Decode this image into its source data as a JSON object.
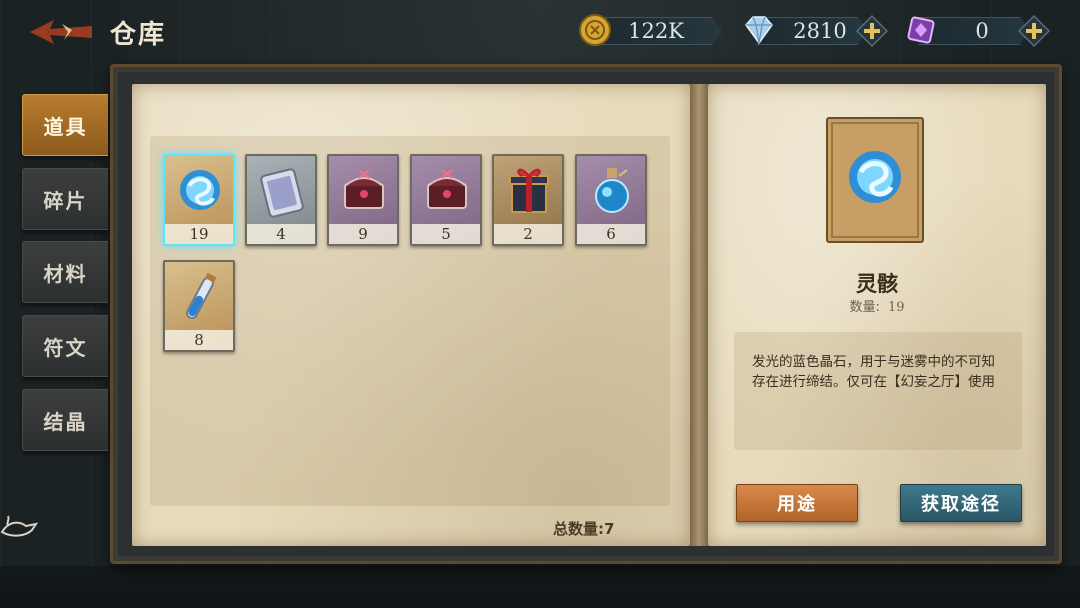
{
  "header": {
    "title": "仓库",
    "currencies": [
      {
        "name": "coin",
        "value": "122K",
        "icon": "gold-coin-icon",
        "has_plus": false
      },
      {
        "name": "diamond",
        "value": "2810",
        "icon": "diamond-icon",
        "has_plus": true
      },
      {
        "name": "crystal",
        "value": "0",
        "icon": "purple-crystal-icon",
        "has_plus": true
      }
    ]
  },
  "tabs": [
    {
      "label": "道具",
      "active": true
    },
    {
      "label": "碎片",
      "active": false
    },
    {
      "label": "材料",
      "active": false
    },
    {
      "label": "符文",
      "active": false
    },
    {
      "label": "结晶",
      "active": false
    }
  ],
  "items": [
    {
      "icon": "blue-spirit-orb-icon",
      "count": "19",
      "rarity": "gold",
      "selected": true
    },
    {
      "icon": "silver-card-icon",
      "count": "4",
      "rarity": "gray",
      "selected": false
    },
    {
      "icon": "red-chest-icon",
      "count": "9",
      "rarity": "purple",
      "selected": false
    },
    {
      "icon": "red-chest-icon",
      "count": "5",
      "rarity": "purple",
      "selected": false
    },
    {
      "icon": "gift-box-icon",
      "count": "2",
      "rarity": "gold",
      "selected": false
    },
    {
      "icon": "blue-potion-icon",
      "count": "6",
      "rarity": "purple",
      "selected": false
    },
    {
      "icon": "blue-vial-icon",
      "count": "8",
      "rarity": "gold",
      "selected": false
    }
  ],
  "total_label": "总数量:7",
  "detail": {
    "name": "灵骸",
    "qty_label": "数量:",
    "qty_value": "19",
    "description": "发光的蓝色晶石，用于与迷雾中的不可知存在进行缔结。仅可在【幻妄之厅】使用",
    "use_button": "用途",
    "source_button": "获取途径"
  },
  "colors": {
    "gold_frame": "#c9a46a",
    "gray_frame": "#8b9296",
    "purple_frame": "#8a6c92",
    "selected": "#5ee4ff",
    "tab_active": "#b87d2e"
  }
}
